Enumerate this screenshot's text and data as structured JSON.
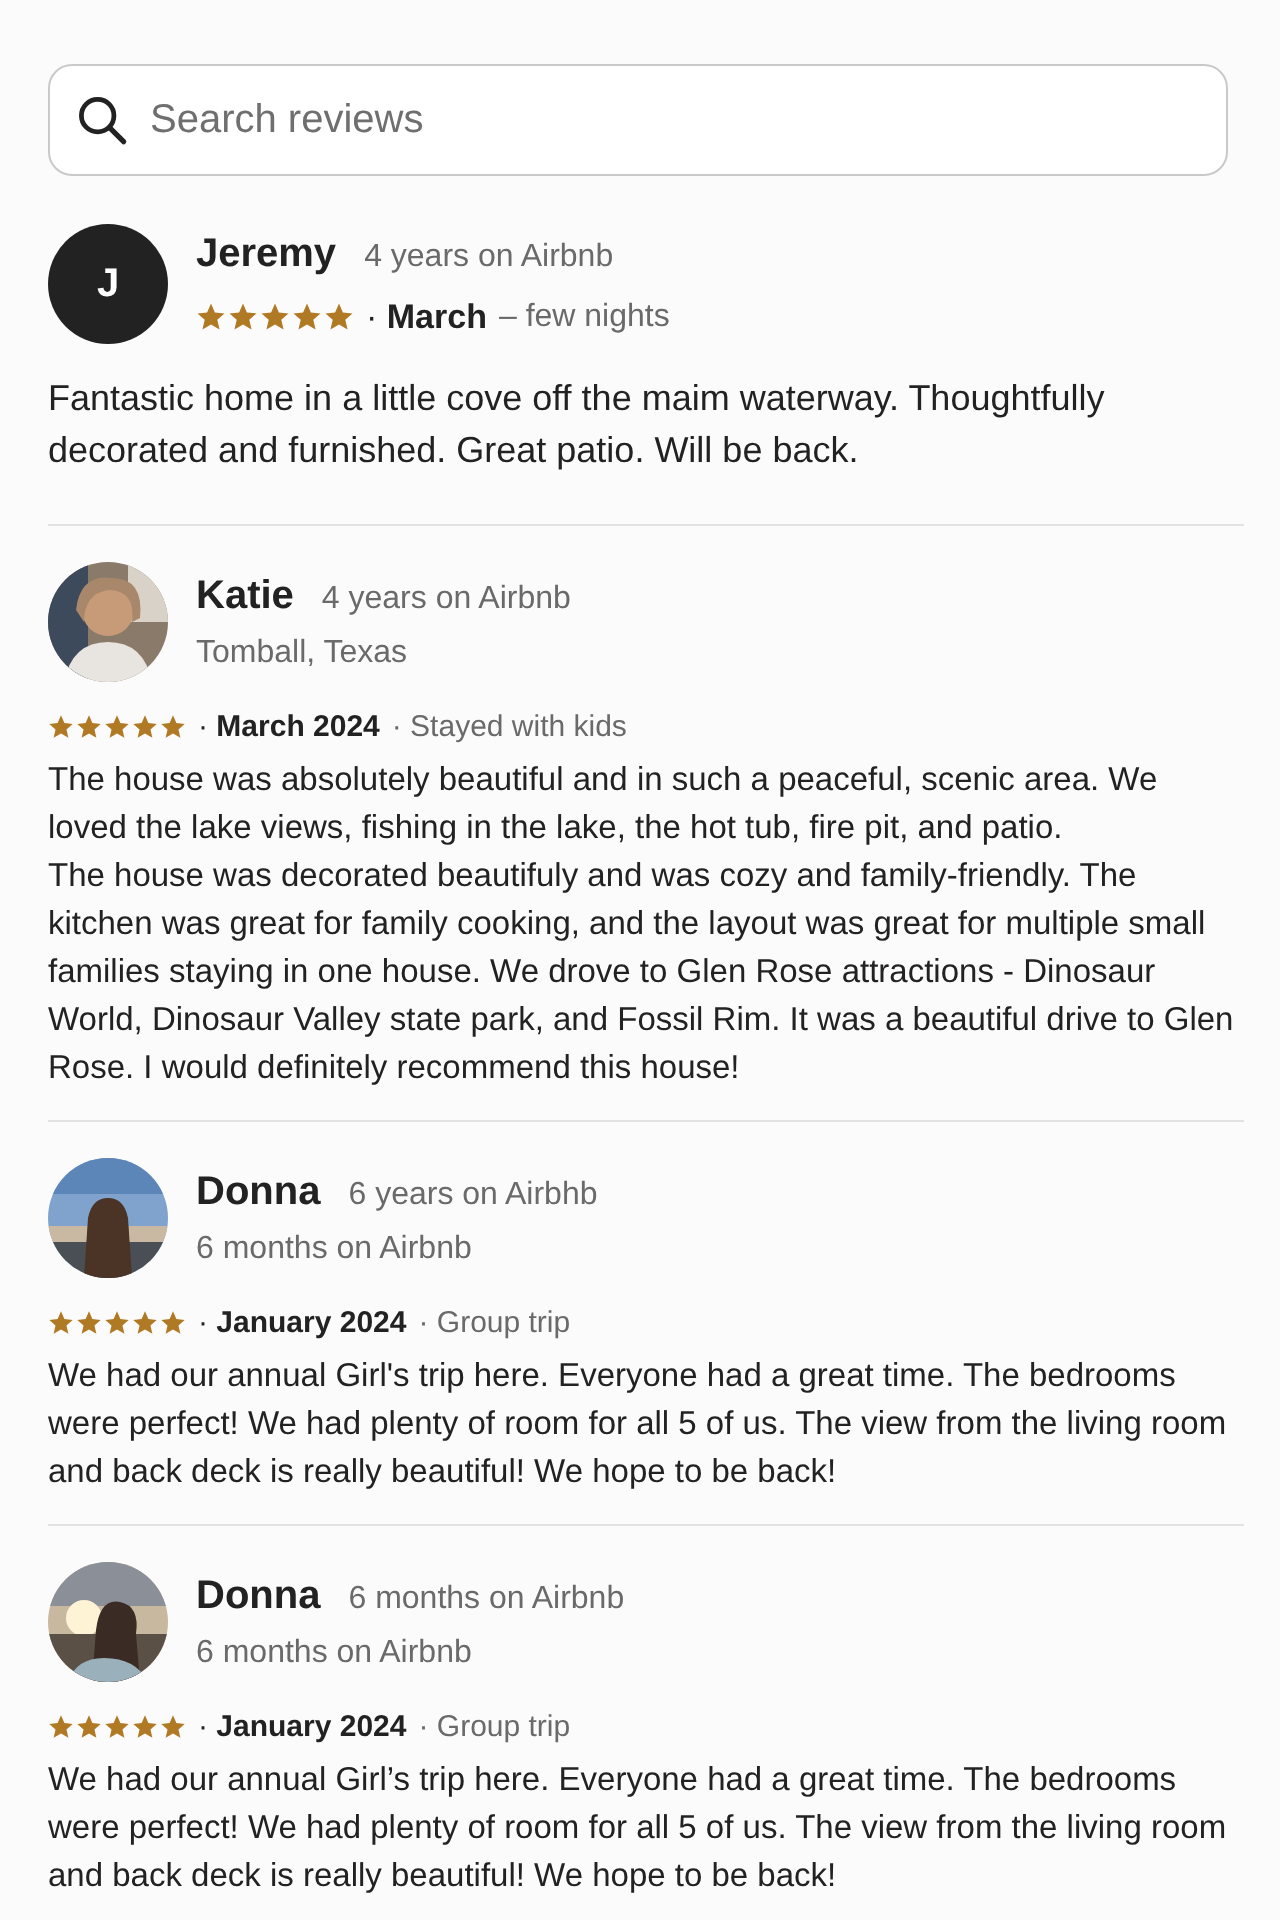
{
  "search": {
    "placeholder": "Search reviews"
  },
  "reviews": [
    {
      "kind": "compact",
      "avatar": {
        "kind": "letter",
        "letter": "J"
      },
      "name": "Jeremy",
      "tenure": "4 years on Airbnb",
      "stars": 5,
      "date": "· **March**",
      "trip": "– few nights",
      "text": "Fantastic home in a little cove off the maim waterway. Thoughtfully decorated and furnished. Great patio. Will be back."
    },
    {
      "kind": "full",
      "name": "Katie",
      "tenure": "4 years on Airbnb",
      "subtitle": "Tomball, Texas",
      "stars": 5,
      "date": "· **March 2024**",
      "trip": "· Stayed with kids",
      "text": "The house was absolutely beautiful and in such a peaceful, scenic area. We loved the lake views, fishing in the lake, the hot tub, fire pit, and patio.\nThe house was decorated beautifuly and was cozy and family-friendly. The kitchen was great for family cooking, and the layout was great for multiple small families staying in one house. We drove to Glen Rose attractions - Dinosaur World, Dinosaur Valley state park, and Fossil Rim. It was a beautiful drive to Glen Rose. I would definitely recommend this house!"
    },
    {
      "kind": "full",
      "name": "Donna",
      "tenure": "6 years on Airbhb",
      "subtitle": "6 months on Airbnb",
      "stars": 5,
      "date": "· **January 2024**",
      "trip": "· Group trip",
      "text": "We had our annual Girl's trip here. Everyone had a great time. The bedrooms were perfect! We had plenty of room for all 5 of us. The view from the living room and back deck is really beautiful! We hope to be back!"
    },
    {
      "kind": "full",
      "name": "Donna",
      "tenure": "6 months on Airbnb",
      "subtitle": "6 months on Airbnb",
      "stars": 5,
      "date": "· **January 2024**",
      "trip": "· Group trip",
      "text": "We had our annual Girl’s trip here. Everyone had a great time. The bedrooms were perfect! We had plenty of room for all 5 of us. The view from the living room and back deck is really beautiful! We hope to be back!"
    }
  ]
}
